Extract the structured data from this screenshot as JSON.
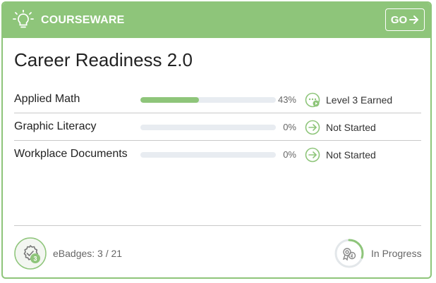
{
  "header": {
    "title": "COURSEWARE",
    "go_label": "GO",
    "icon": "lightbulb-icon",
    "accent_color": "#8ec57a"
  },
  "course": {
    "title": "Career Readiness 2.0"
  },
  "modules": [
    {
      "name": "Applied Math",
      "progress_percent": 43,
      "progress_label": "43%",
      "status": "Level 3 Earned",
      "status_icon": "level-earned-icon"
    },
    {
      "name": "Graphic Literacy",
      "progress_percent": 0,
      "progress_label": "0%",
      "status": "Not Started",
      "status_icon": "arrow-circle-icon"
    },
    {
      "name": "Workplace Documents",
      "progress_percent": 0,
      "progress_label": "0%",
      "status": "Not Started",
      "status_icon": "arrow-circle-icon"
    }
  ],
  "footer": {
    "ebadges_label": "eBadges: 3 / 21",
    "ebadge_count": "3",
    "status_label": "In Progress",
    "status_ring_fraction": 0.3
  }
}
